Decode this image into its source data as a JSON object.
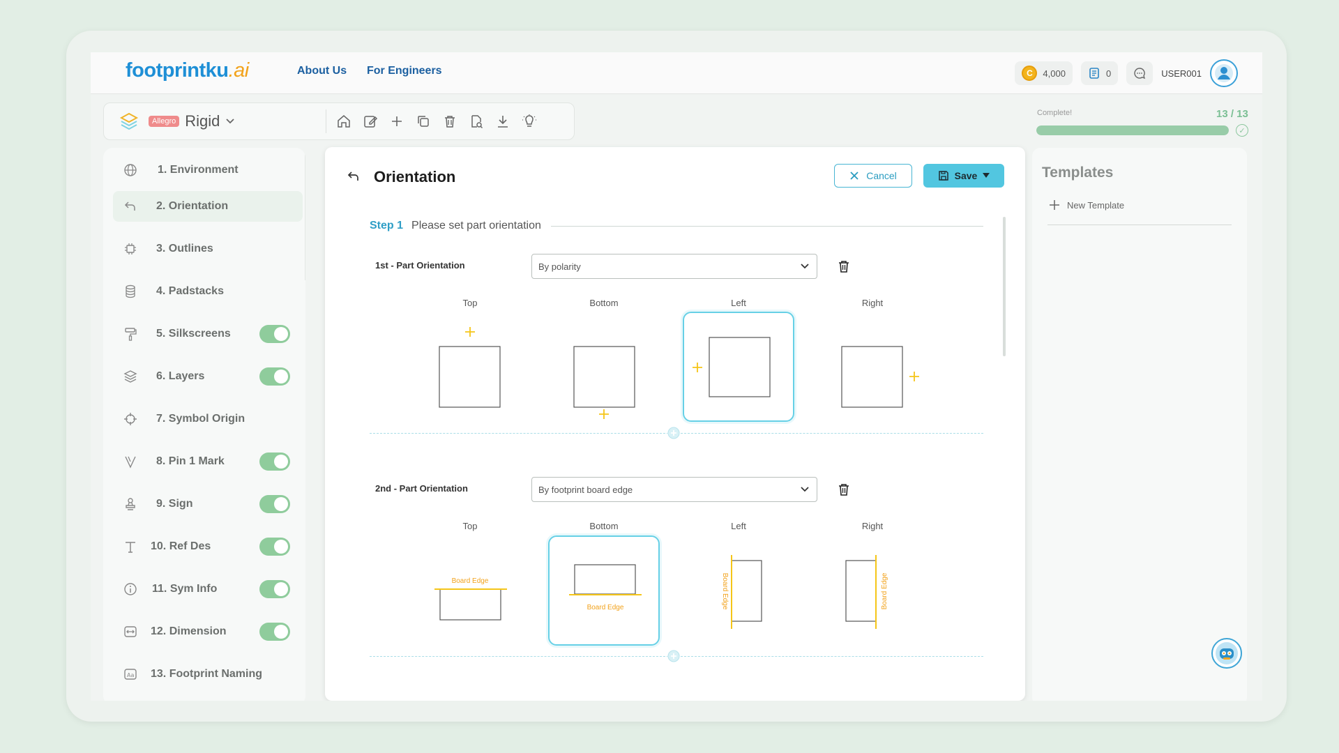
{
  "header": {
    "logo_main": "footprintku",
    "logo_ai": ".ai",
    "nav": [
      "About Us",
      "For Engineers"
    ],
    "credits": "4,000",
    "credit_symbol": "C",
    "docs_count": "0",
    "username": "USER001"
  },
  "toolbar": {
    "badge": "Allegro",
    "board_type": "Rigid"
  },
  "progress": {
    "label": "Complete!",
    "count": "13 / 13",
    "fraction": 1.0
  },
  "sidebar": {
    "items": [
      {
        "num": "1.",
        "label": "Environment",
        "toggle": false
      },
      {
        "num": "2.",
        "label": "Orientation",
        "toggle": false,
        "active": true
      },
      {
        "num": "3.",
        "label": "Outlines",
        "toggle": false
      },
      {
        "num": "4.",
        "label": "Padstacks",
        "toggle": false
      },
      {
        "num": "5.",
        "label": "Silkscreens",
        "toggle": true
      },
      {
        "num": "6.",
        "label": "Layers",
        "toggle": true
      },
      {
        "num": "7.",
        "label": "Symbol Origin",
        "toggle": false
      },
      {
        "num": "8.",
        "label": "Pin 1 Mark",
        "toggle": true
      },
      {
        "num": "9.",
        "label": "Sign",
        "toggle": true
      },
      {
        "num": "10.",
        "label": "Ref Des",
        "toggle": true
      },
      {
        "num": "11.",
        "label": "Sym Info",
        "toggle": true
      },
      {
        "num": "12.",
        "label": "Dimension",
        "toggle": true
      },
      {
        "num": "13.",
        "label": "Footprint Naming",
        "toggle": false
      }
    ]
  },
  "main": {
    "title": "Orientation",
    "cancel_label": "Cancel",
    "save_label": "Save",
    "step_number": "Step 1",
    "step_text": "Please set part orientation",
    "orientations": [
      {
        "label": "1st - Part Orientation",
        "selected_value": "By polarity",
        "options": [
          "Top",
          "Bottom",
          "Left",
          "Right"
        ],
        "selected": "Left"
      },
      {
        "label": "2nd - Part Orientation",
        "selected_value": "By footprint board edge",
        "options": [
          "Top",
          "Bottom",
          "Left",
          "Right"
        ],
        "selected": "Bottom",
        "edge_text": "Board Edge"
      }
    ]
  },
  "templates": {
    "title": "Templates",
    "new_label": "New Template"
  },
  "colors": {
    "accent": "#52c6e0",
    "brand_blue": "#1e8fd6",
    "brand_orange": "#f2a21b",
    "marker_yellow": "#f5c518",
    "toggle_green": "#8fcc9c"
  }
}
